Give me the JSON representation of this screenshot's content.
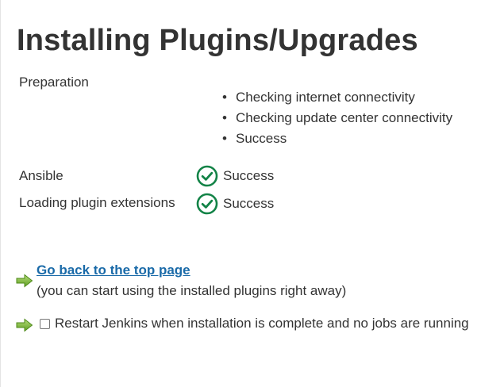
{
  "page": {
    "title": "Installing Plugins/Upgrades"
  },
  "statuses": {
    "preparation": {
      "label": "Preparation",
      "items": [
        "Checking internet connectivity",
        "Checking update center connectivity",
        "Success"
      ]
    },
    "ansible": {
      "label": "Ansible",
      "value": "Success"
    },
    "plugin_extensions": {
      "label": "Loading plugin extensions",
      "value": "Success"
    }
  },
  "actions": {
    "top_page_link": "Go back to the top page",
    "top_page_note": "(you can start using the installed plugins right away)",
    "restart_label": "Restart Jenkins when installation is complete and no jobs are running",
    "restart_checked": false
  },
  "colors": {
    "success_green": "#138347",
    "link_blue": "#1a6aa8",
    "arrow_green": "#7cb342"
  },
  "icons": {
    "success": "check-circle-icon",
    "action": "green-arrow-icon"
  }
}
